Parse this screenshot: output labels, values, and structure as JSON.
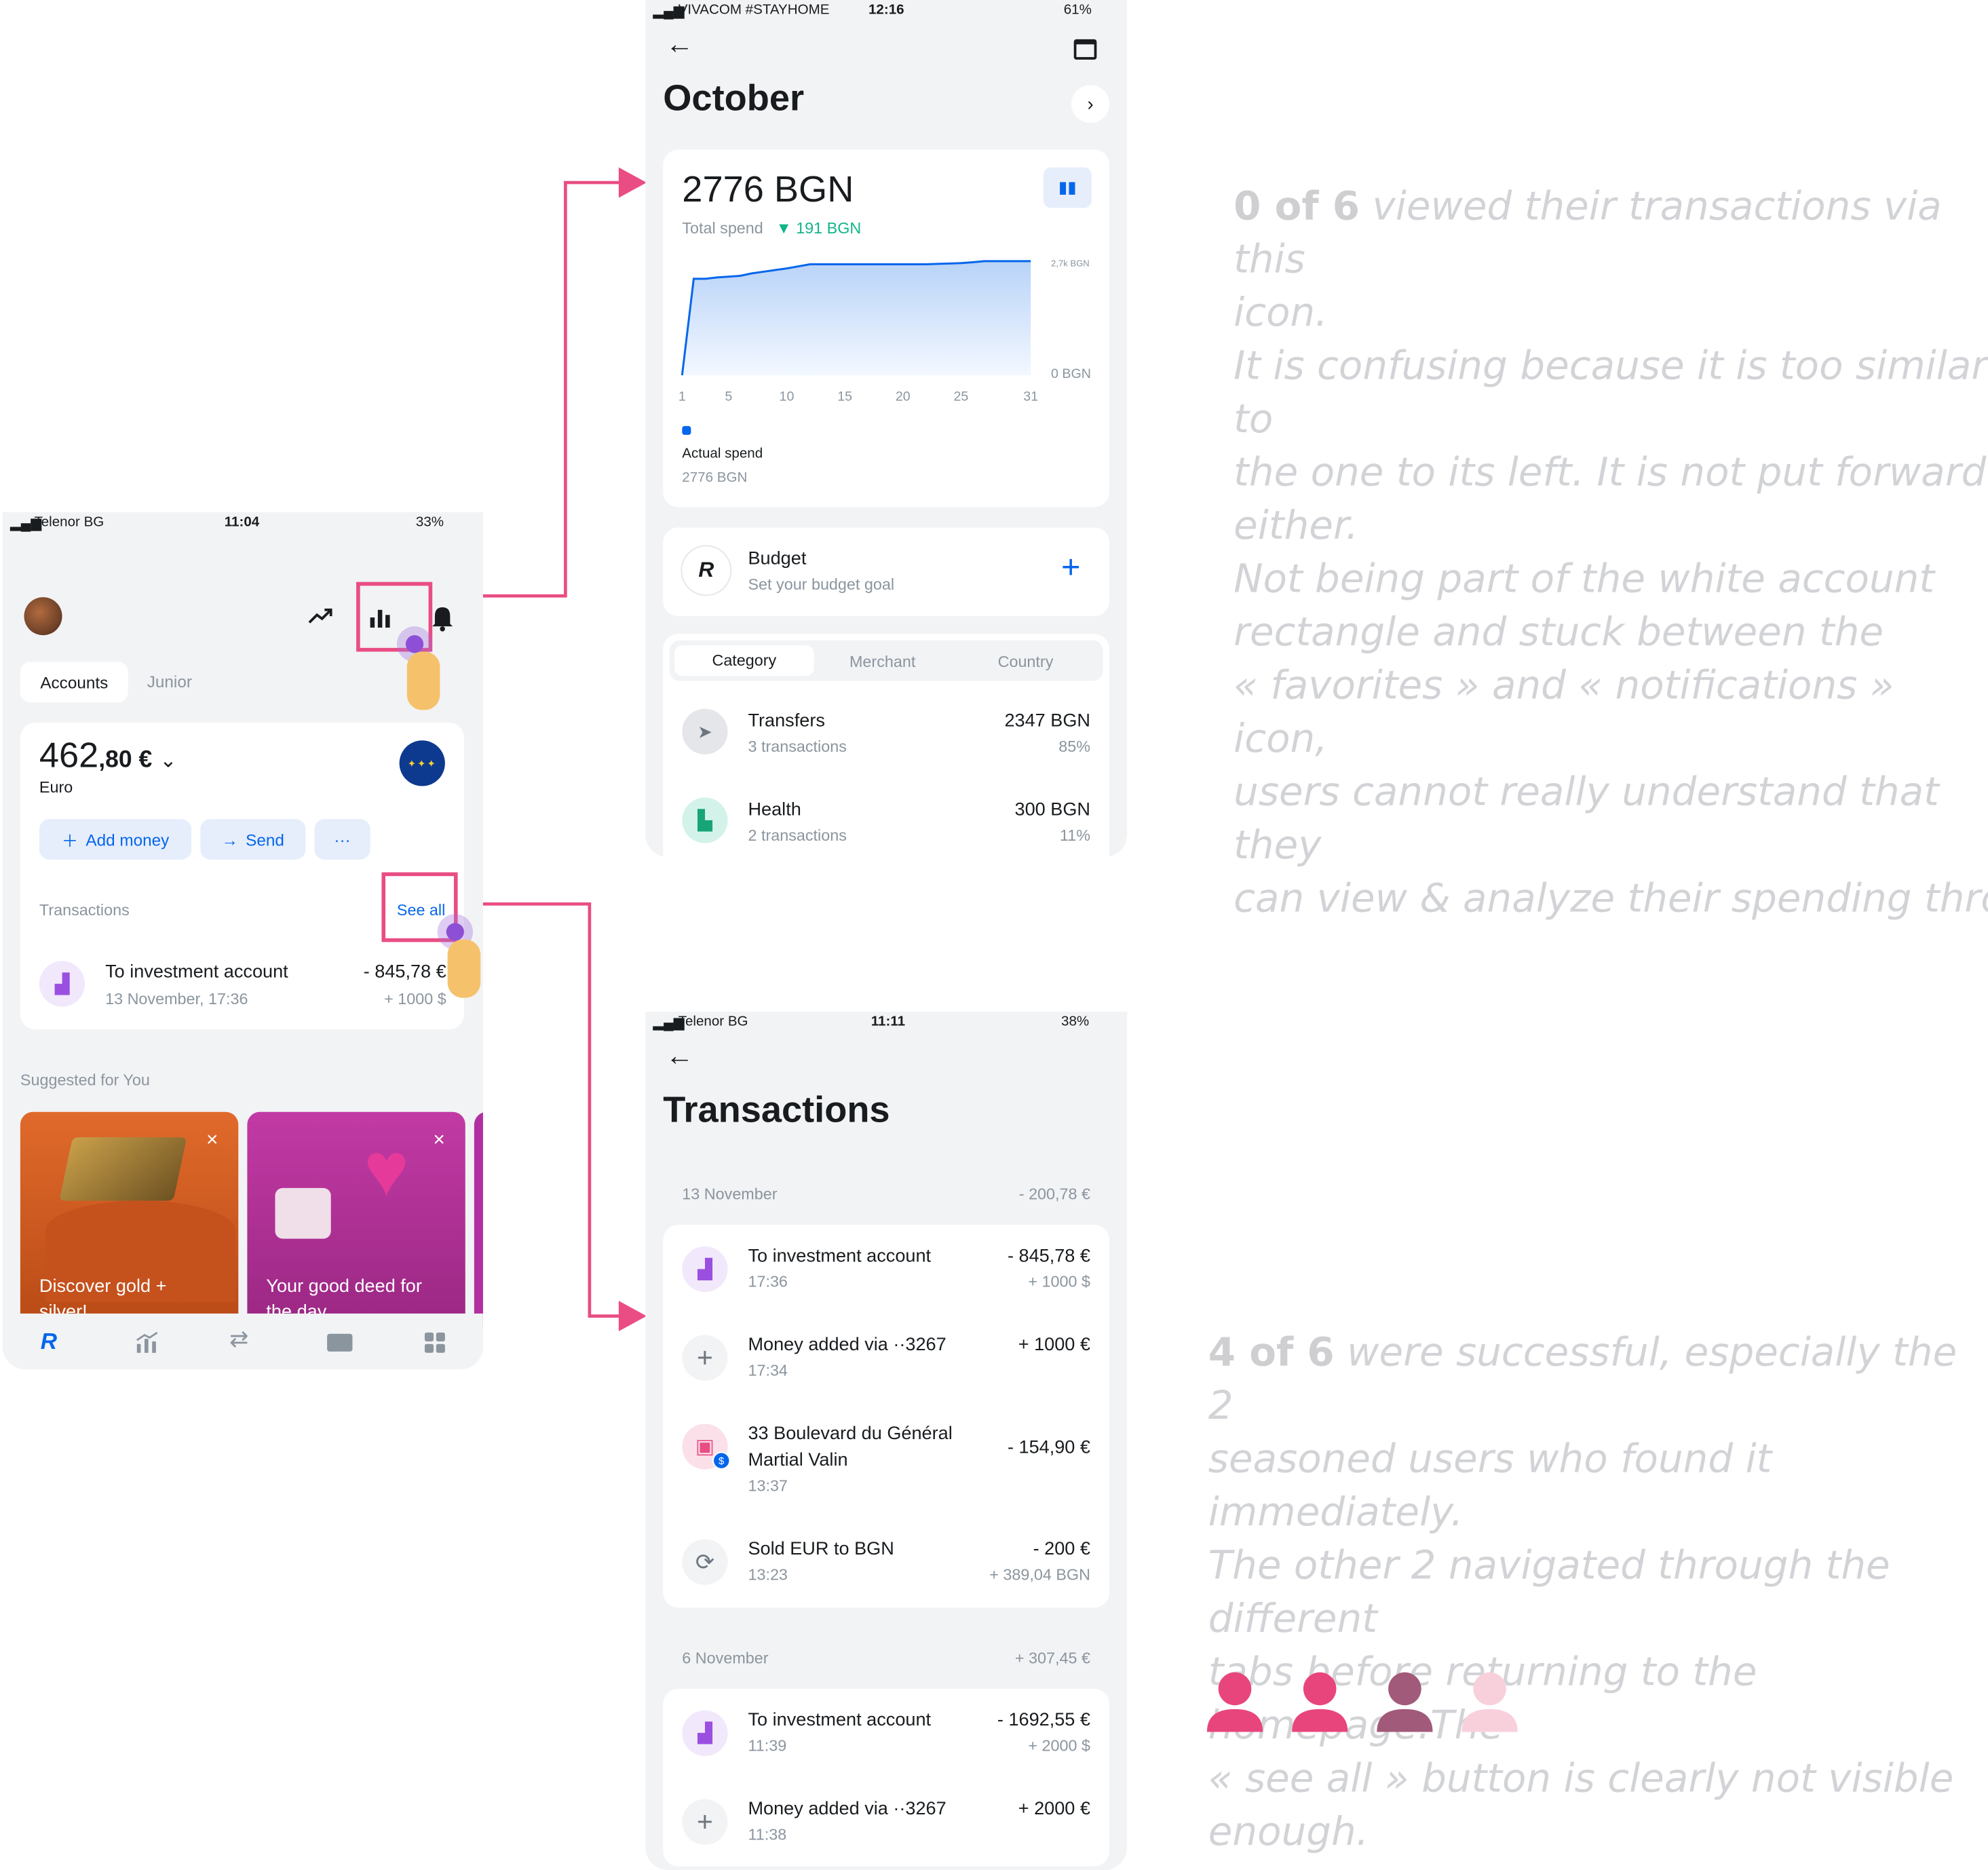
{
  "home": {
    "status": {
      "carrier": "Telenor BG",
      "time": "11:04",
      "battery": "33%"
    },
    "tabs": [
      "Accounts",
      "Junior"
    ],
    "balance_int": "462",
    "balance_dec": ",80 €",
    "currency": "Euro",
    "actions": {
      "add": "Add money",
      "send": "Send",
      "more": "···"
    },
    "tx_header": "Transactions",
    "see_all": "See all",
    "tx": {
      "title": "To investment account",
      "sub": "13 November, 17:36",
      "amount": "- 845,78 €",
      "amount2": "+ 1000 $"
    },
    "suggested": "Suggested for You",
    "cards": [
      "Discover gold + silver!",
      "Your good deed for the day"
    ],
    "close": "×"
  },
  "stats": {
    "status": {
      "carrier": "VIVACOM #STAYHOME",
      "time": "12:16",
      "battery": "61%"
    },
    "month": "October",
    "total": "2776 BGN",
    "total_label": "Total spend",
    "delta": "▼ 191 BGN",
    "chart": {
      "top_label": "2,7k BGN",
      "zero_label": "0 BGN"
    },
    "legend_label": "Actual spend",
    "legend_value": "2776 BGN",
    "budget_title": "Budget",
    "budget_sub": "Set your budget goal",
    "budget_logo": "R",
    "seg": [
      "Category",
      "Merchant",
      "Country"
    ],
    "rows": [
      {
        "title": "Transfers",
        "sub": "3 transactions",
        "amount": "2347 BGN",
        "pct": "85%"
      },
      {
        "title": "Health",
        "sub": "2 transactions",
        "amount": "300 BGN",
        "pct": "11%"
      }
    ]
  },
  "chart_data": {
    "type": "area",
    "x": [
      1,
      2,
      3,
      4,
      5,
      6,
      7,
      8,
      9,
      10,
      11,
      12,
      13,
      14,
      15,
      16,
      17,
      18,
      19,
      20,
      21,
      22,
      23,
      24,
      25,
      26,
      27,
      28,
      29,
      30,
      31
    ],
    "series": [
      {
        "name": "Actual spend",
        "values": [
          0,
          2347,
          2347,
          2380,
          2400,
          2420,
          2480,
          2520,
          2560,
          2600,
          2650,
          2700,
          2700,
          2700,
          2700,
          2700,
          2700,
          2700,
          2700,
          2700,
          2700,
          2700,
          2710,
          2720,
          2730,
          2750,
          2776,
          2776,
          2776,
          2776,
          2776
        ]
      }
    ],
    "xticks": [
      "1",
      "5",
      "10",
      "15",
      "20",
      "25",
      "31"
    ],
    "ylim": [
      0,
      2776
    ],
    "ytick_labels": [
      "0 BGN",
      "2,7k BGN"
    ],
    "colors": {
      "line": "#0666eb",
      "fill": "#b8d3f8"
    }
  },
  "txs": {
    "status": {
      "carrier": "Telenor BG",
      "time": "11:11",
      "battery": "38%"
    },
    "title": "Transactions",
    "groups": [
      {
        "date": "13 November",
        "total": "- 200,78 €",
        "items": [
          {
            "title": "To investment account",
            "sub": "17:36",
            "amount": "- 845,78 €",
            "amount2": "+ 1000 $"
          },
          {
            "title": "Money added via ··3267",
            "sub": "17:34",
            "amount": "+ 1000 €",
            "amount2": ""
          },
          {
            "title": "33 Boulevard du Général",
            "title2": "Martial Valin",
            "sub": "13:37",
            "amount": "- 154,90 €",
            "amount2": ""
          },
          {
            "title": "Sold EUR to BGN",
            "sub": "13:23",
            "amount": "- 200 €",
            "amount2": "+ 389,04 BGN"
          }
        ]
      },
      {
        "date": "6 November",
        "total": "+ 307,45 €",
        "items": [
          {
            "title": "To investment account",
            "sub": "11:39",
            "amount": "- 1692,55 €",
            "amount2": "+ 2000 $"
          },
          {
            "title": "Money added via ··3267",
            "sub": "11:38",
            "amount": "+ 2000 €",
            "amount2": ""
          }
        ]
      }
    ]
  },
  "note1": {
    "bold": "0 of 6",
    "lines": [
      " viewed their transactions via this",
      "icon.",
      "It is confusing because it is too similar to",
      "the one to its left. It is not put forward",
      "either.",
      "Not being part of the white account",
      "rectangle and stuck between the",
      "« favorites » and « notifications » icon,",
      "users cannot really understand that they",
      "can view & analyze their spending through"
    ]
  },
  "note2": {
    "bold": "4 of 6",
    "lines": [
      " were successful, especially the 2",
      "seasoned users who found it immediately.",
      "The other 2 navigated through the different",
      "tabs before returning to the homepage.The",
      "« see all » button is clearly not visible",
      "enough."
    ]
  },
  "colors": {
    "accent": "#e94d84",
    "brand": "#0666eb",
    "user_full": "#e8457c",
    "user_partial": "#a25a7a",
    "user_none": "#f8d0dc"
  }
}
